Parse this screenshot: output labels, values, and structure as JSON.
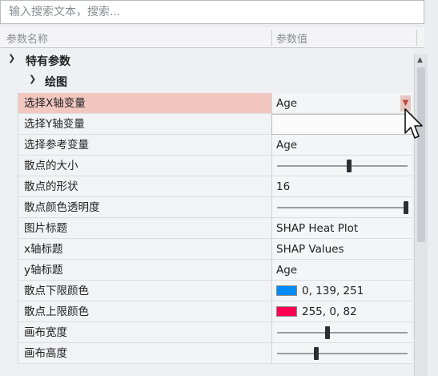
{
  "search": {
    "placeholder": "输入搜索文本，搜索..."
  },
  "columns": {
    "name": "参数名称",
    "value": "参数值"
  },
  "categories": {
    "specific": "特有参数",
    "plot": "绘图"
  },
  "rows": {
    "x_var": {
      "label": "选择X轴变量",
      "value": "Age"
    },
    "y_var": {
      "label": "选择Y轴变量",
      "value": ""
    },
    "ref_var": {
      "label": "选择参考变量",
      "value": "Age"
    },
    "point_size": {
      "label": "散点的大小",
      "level": 0.55
    },
    "point_shape": {
      "label": "散点的形状",
      "value": "16"
    },
    "alpha": {
      "label": "散点颜色透明度",
      "level": 1.0
    },
    "title": {
      "label": "图片标题",
      "value": "SHAP Heat Plot"
    },
    "xlab": {
      "label": "x轴标题",
      "value": "SHAP Values"
    },
    "ylab": {
      "label": "y轴标题",
      "value": "Age"
    },
    "low_color": {
      "label": "散点下限颜色",
      "value": "0, 139, 251",
      "color": "#008bfb"
    },
    "high_color": {
      "label": "散点上限颜色",
      "value": "255, 0, 82",
      "color": "#ff0052"
    },
    "width": {
      "label": "画布宽度",
      "level": 0.38
    },
    "height": {
      "label": "画布高度",
      "level": 0.29
    }
  },
  "icons": {
    "expand": "chevron-down-icon",
    "dropdown": "dropdown-arrow-icon",
    "cursor": "mouse-pointer-icon"
  },
  "colors": {
    "selected_row": "#f2c7c0"
  }
}
